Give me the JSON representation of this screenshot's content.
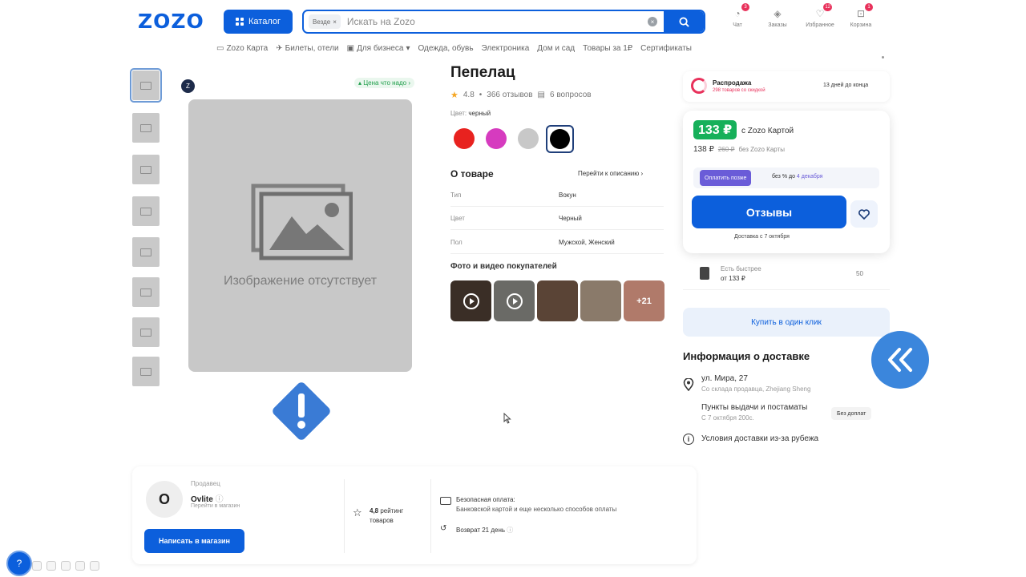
{
  "header": {
    "logo": "ZOZO",
    "catalog_label": "Каталог",
    "search_chip": "Везде",
    "search_placeholder": "Искать на Zozo",
    "icons": [
      {
        "name": "bell-icon",
        "label": "Чат",
        "badge": "3"
      },
      {
        "name": "orders-icon",
        "label": "Заказы",
        "badge": ""
      },
      {
        "name": "favorites-icon",
        "label": "Избранное",
        "badge": "12"
      },
      {
        "name": "cart-icon",
        "label": "Корзина",
        "badge": "1"
      }
    ]
  },
  "topnav": [
    "Zozo Карта",
    "Билеты, отели",
    "Для бизнеса",
    "Одежда, обувь",
    "Электроника",
    "Дом и сад",
    "Товары за 1₽",
    "Сертификаты"
  ],
  "gallery": {
    "thumb_count": 8,
    "price_tag": "Цена что надо",
    "brand_icon_text": "Z",
    "placeholder_caption": "Изображение отсутствует"
  },
  "product": {
    "title": "Пепелац",
    "rating": "4.8",
    "reviews": "366 отзывов",
    "questions": "6 вопросов",
    "color_label": "Цвет:",
    "color_value": "черный",
    "swatches": [
      "#e8221f",
      "#d63bbf",
      "#c8c8c8",
      "#000000"
    ],
    "about_title": "О товаре",
    "about_link": "Перейти к описанию ›",
    "props": [
      {
        "key": "Тип",
        "value": "Вокун"
      },
      {
        "key": "Цвет",
        "value": "Черный"
      },
      {
        "key": "Пол",
        "value": "Мужской, Женский"
      }
    ],
    "photos_title": "Фото и видео покупателей",
    "photos_more": "+21"
  },
  "buy": {
    "sale_title": "Распродажа",
    "sale_sub": "298 товаров со скидкой",
    "sale_days": "13 дней до конца",
    "price_card": "133 ₽",
    "price_card_label": "с Zozo Картой",
    "price_regular": "138 ₽",
    "price_old": "260 ₽",
    "price_no_card": "без Zozo Карты",
    "split_btn": "Оплатить позже",
    "split_text_a": "без % до ",
    "split_text_b": "4 декабря",
    "reviews_btn": "Отзывы",
    "delivery_date": "Доставка с 7 октября",
    "faster_t1": "Есть быстрее",
    "faster_t2": "от 133 ₽",
    "faster_n": "50",
    "one_click": "Купить в один клик"
  },
  "delivery": {
    "title": "Информация о доставке",
    "addr1": "ул. Мира, 27",
    "addr2": "Со склада продавца, Zhejiang Sheng",
    "pvz1": "Пункты выдачи и постаматы",
    "pvz2": "С 7 октября 200с.",
    "nopay": "Без доплат",
    "abroad": "Условия доставки из-за рубежа"
  },
  "seller": {
    "avatar_letter": "O",
    "label": "Продавец",
    "name": "Ovlite",
    "link": "Перейти в магазин",
    "write_btn": "Написать в магазин",
    "rating_value": "4,8",
    "rating_text": "рейтинг",
    "rating_text2": "товаров",
    "pay_t1": "Безопасная оплата:",
    "pay_t2": "Банковской картой и еще несколько способов оплаты",
    "return_text": "Возврат 21 день"
  },
  "colors": {
    "brand": "#0c5fdc",
    "price_green": "#16b05a",
    "sale_pink": "#e8315b",
    "warning_blue": "#3a7bd5"
  }
}
